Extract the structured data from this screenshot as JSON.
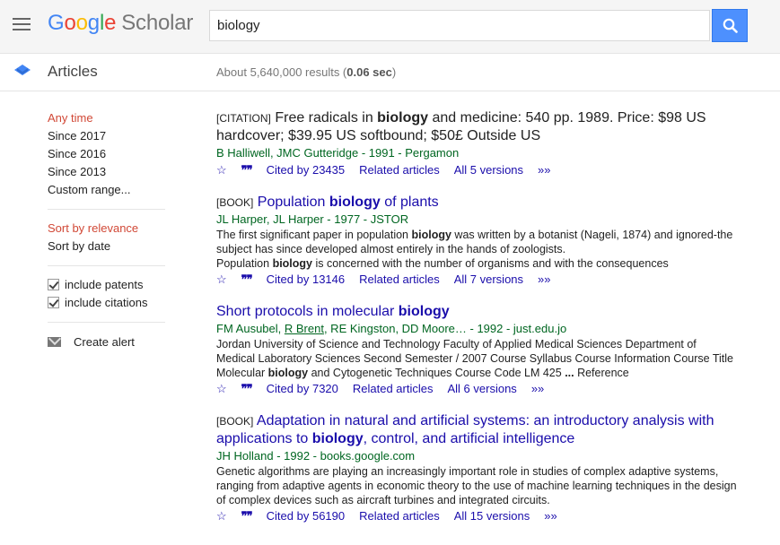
{
  "header": {
    "logo_letters": [
      "G",
      "o",
      "o",
      "g",
      "l",
      "e"
    ],
    "logo_product": "Scholar",
    "search_value": "biology"
  },
  "subheader": {
    "section": "Articles",
    "results_prefix": "About 5,640,000 results (",
    "results_time": "0.06 sec",
    "results_suffix": ")"
  },
  "sidebar": {
    "time_filters": [
      "Any time",
      "Since 2017",
      "Since 2016",
      "Since 2013",
      "Custom range..."
    ],
    "sort_options": [
      "Sort by relevance",
      "Sort by date"
    ],
    "include_patents": "include patents",
    "include_citations": "include citations",
    "create_alert": "Create alert"
  },
  "results": [
    {
      "kind": "[CITATION]",
      "title_a": " Free radicals in ",
      "title_bold": "biology",
      "title_b": " and medicine: 540 pp. 1989. Price: $98 US hardcover; $39.95 US softbound; $50£ Outside US",
      "authors": "B Halliwell, JMC Gutteridge - 1991 - Pergamon",
      "cited_by": "Cited by 23435",
      "related": "Related articles",
      "versions": "All 5 versions"
    },
    {
      "kind": "[BOOK]",
      "title_a": " Population ",
      "title_bold": "biology",
      "title_b": " of plants",
      "authors": "JL Harper, JL Harper - 1977 - JSTOR",
      "snippet_1a": "The first significant paper in population ",
      "snippet_1b": "biology",
      "snippet_1c": " was written by a botanist (Nageli, 1874) and ignored-the subject has since developed almost entirely in the hands of zoologists.",
      "snippet_2a": "Population ",
      "snippet_2b": "biology",
      "snippet_2c": " is concerned with the number of organisms and with the consequences",
      "cited_by": "Cited by 13146",
      "related": "Related articles",
      "versions": "All 7 versions"
    },
    {
      "title_a": "Short protocols in molecular ",
      "title_bold": "biology",
      "authors_a": "FM Ausubel, ",
      "authors_link": "R Brent",
      "authors_b": ", RE Kingston, DD Moore… - 1992 - just.edu.jo",
      "snippet_a": "Jordan University of Science and Technology Faculty of Applied Medical Sciences Department of Medical Laboratory Sciences Second Semester / 2007 Course Syllabus Course Information Course Title Molecular ",
      "snippet_bold": "biology",
      "snippet_b": " and Cytogenetic Techniques Course Code LM 425 ",
      "snippet_ellipsis": "...",
      "snippet_c": " Reference",
      "cited_by": "Cited by 7320",
      "related": "Related articles",
      "versions": "All 6 versions"
    },
    {
      "kind": "[BOOK]",
      "title_a": " Adaptation in natural and artificial systems: an introductory analysis with applications to ",
      "title_bold": "biology",
      "title_b": ", control, and artificial intelligence",
      "authors": "JH Holland - 1992 - books.google.com",
      "snippet": "Genetic algorithms are playing an increasingly important role in studies of complex adaptive systems, ranging from adaptive agents in economic theory to the use of machine learning techniques in the design of complex devices such as aircraft turbines and integrated circuits.",
      "cited_by": "Cited by 56190",
      "related": "Related articles",
      "versions": "All 15 versions"
    }
  ],
  "icons": {
    "star": "☆",
    "quote": "❞❞",
    "more": "»»"
  },
  "colors": {
    "link": "#1a0dab",
    "author": "#006621",
    "active_filter": "#d14836",
    "search_button": "#4d90fe"
  }
}
